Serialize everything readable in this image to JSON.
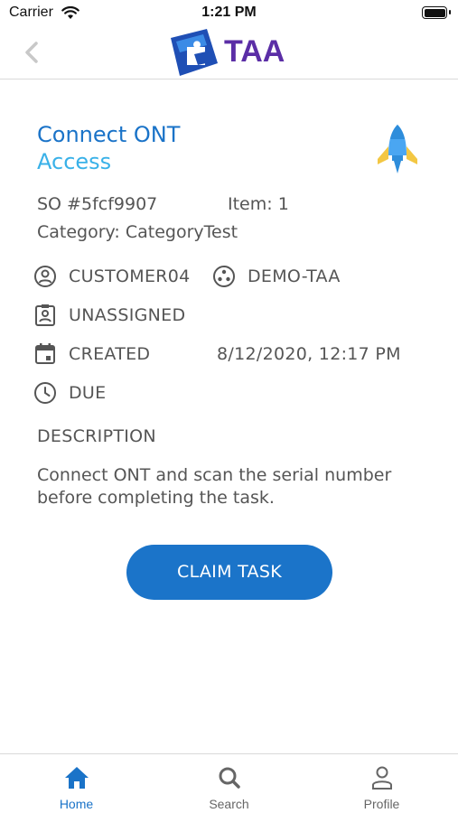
{
  "status_bar": {
    "carrier": "Carrier",
    "time": "1:21 PM"
  },
  "nav": {
    "logo_text": "TAA"
  },
  "task": {
    "title": "Connect ONT",
    "subtitle": "Access",
    "so": "SO #5fcf9907",
    "item": "Item: 1",
    "category": "Category: CategoryTest",
    "customer": "CUSTOMER04",
    "org": "DEMO-TAA",
    "assignment": "UNASSIGNED",
    "created_label": "CREATED",
    "created_value": "8/12/2020, 12:17 PM",
    "due_label": "DUE",
    "description_label": "DESCRIPTION",
    "description": "Connect ONT and scan the serial number before completing the task."
  },
  "actions": {
    "claim_label": "CLAIM TASK"
  },
  "tabbar": {
    "tabs": [
      {
        "label": "Home",
        "icon": "home-icon",
        "active": true
      },
      {
        "label": "Search",
        "icon": "search-icon",
        "active": false
      },
      {
        "label": "Profile",
        "icon": "profile-icon",
        "active": false
      }
    ]
  },
  "colors": {
    "primary": "#1b74c9",
    "title": "#1a73c8",
    "subtitle": "#39b1e8",
    "logo_text": "#5b2ea6",
    "tab_active": "#1a73c8",
    "tab_inactive": "#666666"
  }
}
